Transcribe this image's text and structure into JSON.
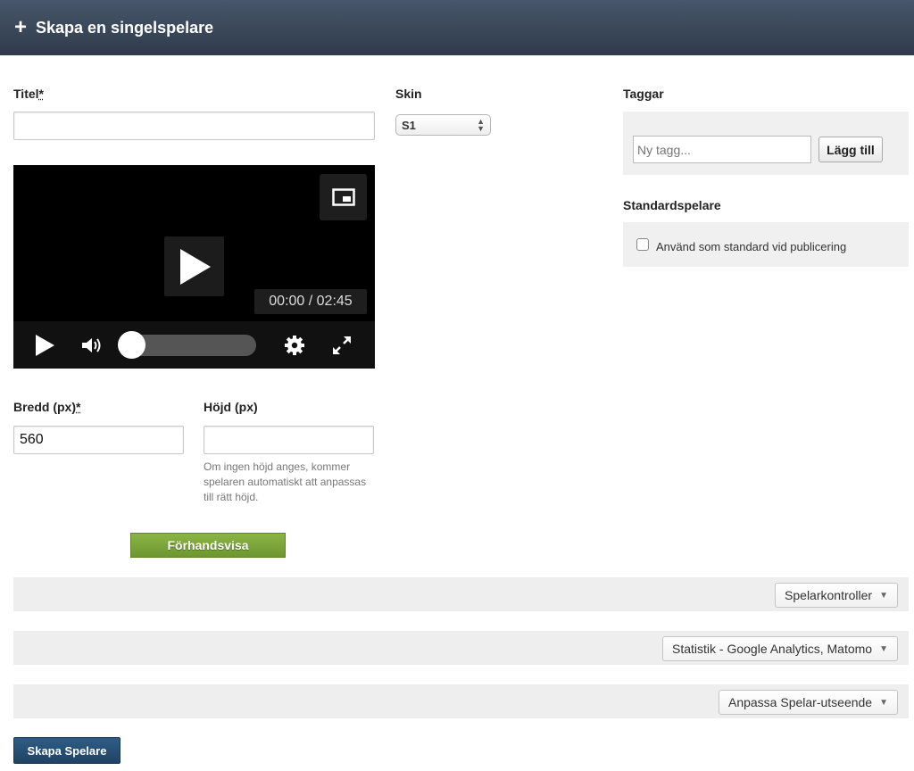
{
  "header": {
    "plus_icon": "+",
    "title": "Skapa en singelspelare"
  },
  "form": {
    "title_label": "Titel",
    "required_mark": "*",
    "title_value": "",
    "width_label": "Bredd (px)",
    "width_value": "560",
    "height_label": "Höjd (px)",
    "height_value": "",
    "height_hint": "Om ingen höjd anges, kommer spelaren automatiskt att anpassas till rätt höjd.",
    "preview_button": "Förhandsvisa"
  },
  "skin": {
    "label": "Skin",
    "selected": "S1"
  },
  "video": {
    "time_display": "00:00 / 02:45",
    "progress": 0,
    "icons": [
      "picture-in-picture-icon",
      "play-icon",
      "volume-icon",
      "settings-icon",
      "fullscreen-icon"
    ]
  },
  "tags": {
    "label": "Taggar",
    "input_placeholder": "Ny tagg...",
    "add_button": "Lägg till"
  },
  "default_player": {
    "label": "Standardspelare",
    "checkbox_label": "Använd som standard vid publicering",
    "checked": false
  },
  "sections": [
    {
      "label": "Spelarkontroller"
    },
    {
      "label": "Statistik - Google Analytics, Matomo"
    },
    {
      "label": "Anpassa Spelar-utseende"
    }
  ],
  "create_button": "Skapa Spelare",
  "colors": {
    "header": "#3a4757",
    "preview_button": "#7ba53b",
    "create_button": "#264f73",
    "panel": "#f0f0f0"
  }
}
